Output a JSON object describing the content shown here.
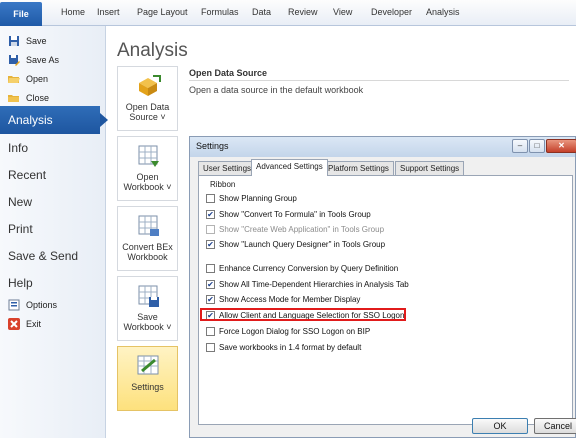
{
  "ribbon": {
    "file": "File",
    "tabs": [
      "Home",
      "Insert",
      "Page Layout",
      "Formulas",
      "Data",
      "Review",
      "View",
      "Developer",
      "Analysis"
    ]
  },
  "nav": {
    "save": "Save",
    "save_as": "Save As",
    "open": "Open",
    "close": "Close",
    "analysis": "Analysis",
    "info": "Info",
    "recent": "Recent",
    "new": "New",
    "print": "Print",
    "save_send": "Save & Send",
    "help": "Help",
    "options": "Options",
    "exit": "Exit"
  },
  "main": {
    "title": "Analysis",
    "buttons": {
      "open_data_source": "Open Data Source ˅",
      "open_workbook": "Open Workbook ˅",
      "convert_bex": "Convert BEx Workbook",
      "save_workbook": "Save Workbook ˅",
      "settings": "Settings"
    },
    "ods_title": "Open Data Source",
    "ods_desc": "Open a data source in the default workbook"
  },
  "dialog": {
    "title": "Settings",
    "tabs": [
      "User Settings",
      "Advanced Settings",
      "Platform Settings",
      "Support Settings"
    ],
    "group": "Ribbon",
    "options": [
      {
        "label": "Show Planning Group",
        "checked": false,
        "disabled": false
      },
      {
        "label": "Show \"Convert To Formula\" in Tools Group",
        "checked": true,
        "disabled": false
      },
      {
        "label": "Show \"Create Web Application\" in Tools Group",
        "checked": false,
        "disabled": true
      },
      {
        "label": "Show \"Launch Query Designer\" in Tools Group",
        "checked": true,
        "disabled": false
      },
      {
        "label": "Enhance Currency Conversion by Query Definition",
        "checked": false,
        "disabled": false
      },
      {
        "label": "Show All Time-Dependent Hierarchies in Analysis Tab",
        "checked": true,
        "disabled": false
      },
      {
        "label": "Show Access Mode for Member Display",
        "checked": true,
        "disabled": false
      },
      {
        "label": "Allow Client and Language Selection for SSO Logon",
        "checked": true,
        "disabled": false
      },
      {
        "label": "Force Logon Dialog for SSO Logon on BIP",
        "checked": false,
        "disabled": false
      },
      {
        "label": "Save workbooks in 1.4 format by default",
        "checked": false,
        "disabled": false
      }
    ],
    "ok": "OK",
    "cancel": "Cancel"
  },
  "colors": {
    "accent": "#1e56a0",
    "highlight": "#e11b1b",
    "settings_active": "#fde17d"
  }
}
